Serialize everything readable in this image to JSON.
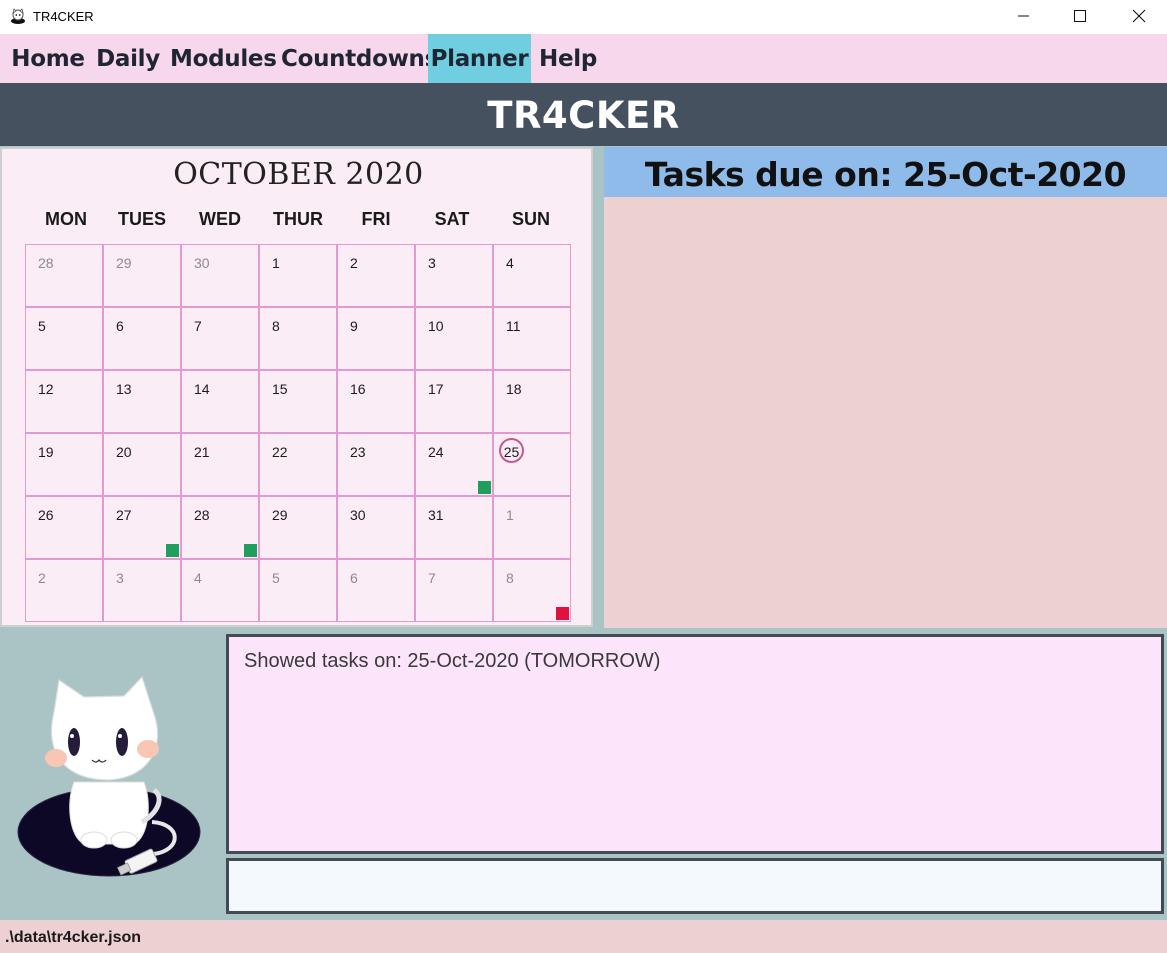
{
  "window": {
    "title": "TR4CKER",
    "controls": [
      "minimize-icon",
      "maximize-icon",
      "close-icon"
    ]
  },
  "menu": {
    "items": [
      {
        "label": "Home"
      },
      {
        "label": "Daily"
      },
      {
        "label": "Modules"
      },
      {
        "label": "Countdowns"
      },
      {
        "label": "Planner",
        "active": true
      },
      {
        "label": "Help"
      }
    ]
  },
  "banner": {
    "title": "TR4CKER"
  },
  "calendar": {
    "month_title": "OCTOBER 2020",
    "days_of_week": [
      "MON",
      "TUES",
      "WED",
      "THUR",
      "FRI",
      "SAT",
      "SUN"
    ],
    "selected_day": "25",
    "weeks": [
      [
        {
          "d": "28",
          "other": true
        },
        {
          "d": "29",
          "other": true
        },
        {
          "d": "30",
          "other": true
        },
        {
          "d": "1"
        },
        {
          "d": "2"
        },
        {
          "d": "3"
        },
        {
          "d": "4"
        }
      ],
      [
        {
          "d": "5"
        },
        {
          "d": "6"
        },
        {
          "d": "7"
        },
        {
          "d": "8"
        },
        {
          "d": "9"
        },
        {
          "d": "10"
        },
        {
          "d": "11"
        }
      ],
      [
        {
          "d": "12"
        },
        {
          "d": "13"
        },
        {
          "d": "14"
        },
        {
          "d": "15"
        },
        {
          "d": "16"
        },
        {
          "d": "17"
        },
        {
          "d": "18"
        }
      ],
      [
        {
          "d": "19"
        },
        {
          "d": "20"
        },
        {
          "d": "21"
        },
        {
          "d": "22"
        },
        {
          "d": "23"
        },
        {
          "d": "24",
          "marker": "green"
        },
        {
          "d": "25",
          "today": true
        }
      ],
      [
        {
          "d": "26"
        },
        {
          "d": "27",
          "marker": "green"
        },
        {
          "d": "28",
          "marker": "green"
        },
        {
          "d": "29"
        },
        {
          "d": "30"
        },
        {
          "d": "31"
        },
        {
          "d": "1",
          "other": true
        }
      ],
      [
        {
          "d": "2",
          "other": true
        },
        {
          "d": "3",
          "other": true
        },
        {
          "d": "4",
          "other": true
        },
        {
          "d": "5",
          "other": true
        },
        {
          "d": "6",
          "other": true
        },
        {
          "d": "7",
          "other": true
        },
        {
          "d": "8",
          "other": true,
          "marker": "red"
        }
      ]
    ],
    "marker_colors": {
      "green": "#1f9e5d",
      "red": "#e0103f"
    }
  },
  "tasks_panel": {
    "title": "Tasks due on: 25-Oct-2020"
  },
  "result_display": {
    "text": "Showed tasks on: 25-Oct-2020 (TOMORROW)"
  },
  "command_box": {
    "value": "",
    "placeholder": ""
  },
  "status_bar": {
    "path": ".\\data\\tr4cker.json"
  },
  "mascot": {
    "icon": "cat-mascot-icon"
  },
  "colors": {
    "menu_bg": "#f7d7eb",
    "menu_active": "#6fcfe0",
    "banner_bg": "#465160",
    "tasks_header_bg": "#8fbbea",
    "tasks_body_bg": "#edd0d2",
    "side_bg": "#aac4c5"
  }
}
